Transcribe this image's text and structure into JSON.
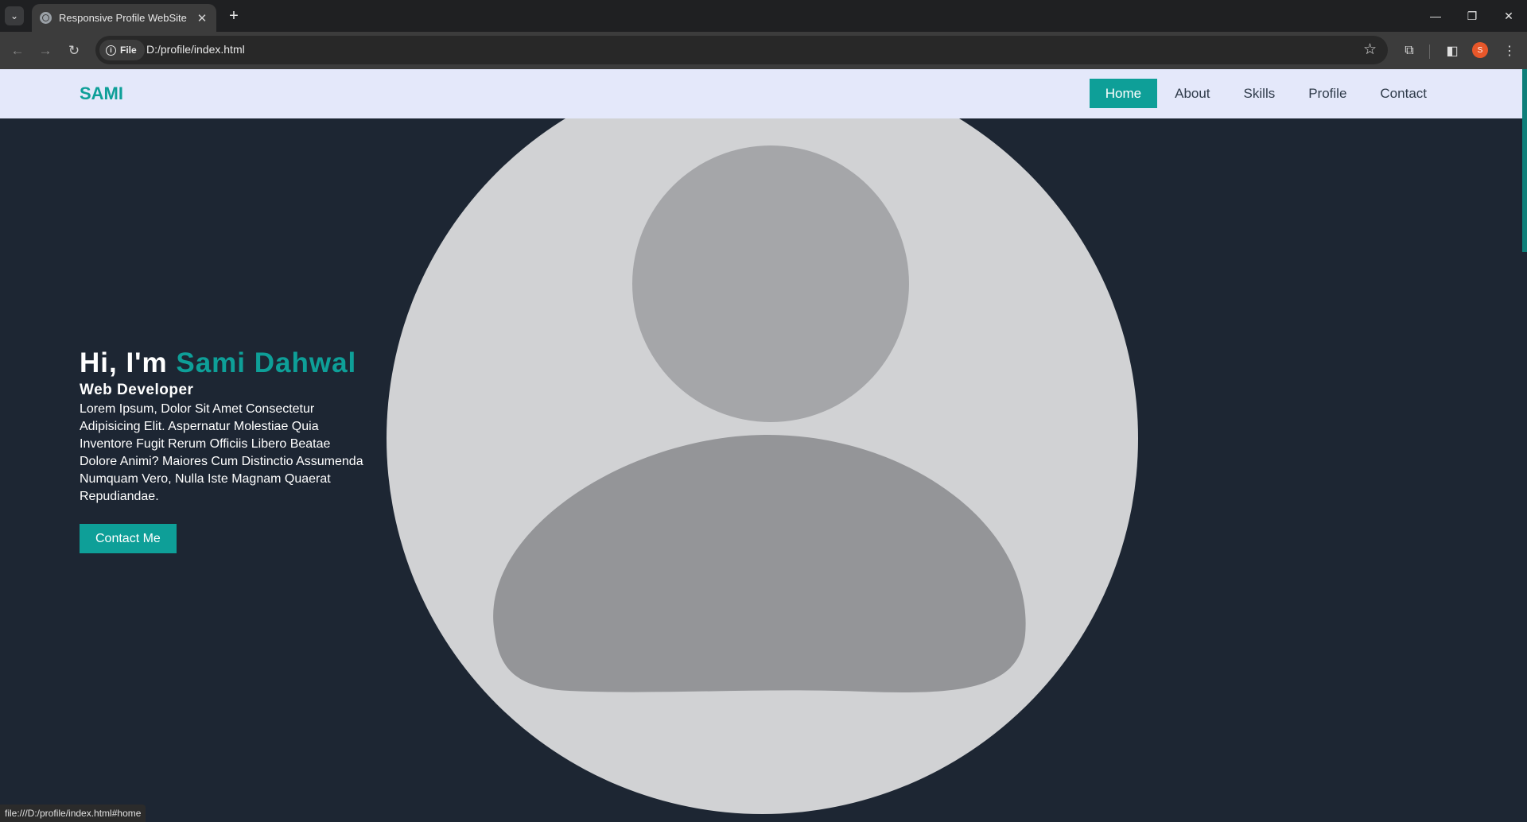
{
  "browser": {
    "tab_title": "Responsive Profile WebSite",
    "tab_close": "✕",
    "new_tab": "+",
    "security_chip": "File",
    "url": "D:/profile/index.html",
    "status_url": "file:///D:/profile/index.html#home",
    "profile_initial": "S",
    "icons": [
      "tab-search-icon",
      "globe-icon",
      "close-icon",
      "plus-icon",
      "back-icon",
      "forward-icon",
      "reload-icon",
      "info-icon",
      "star-icon",
      "extensions-icon",
      "side-panel-icon",
      "minimize-icon",
      "restore-icon",
      "window-close-icon"
    ]
  },
  "site": {
    "logo": "SAMI",
    "nav": [
      {
        "label": "Home",
        "active": true
      },
      {
        "label": "About",
        "active": false
      },
      {
        "label": "Skills",
        "active": false
      },
      {
        "label": "Profile",
        "active": false
      },
      {
        "label": "Contact",
        "active": false
      }
    ],
    "hero": {
      "greeting": "Hi, I'm",
      "name": "Sami Dahwal",
      "role": "Web Developer",
      "description": "Lorem Ipsum, Dolor Sit Amet Consectetur Adipisicing Elit. Aspernatur Molestiae Quia Inventore Fugit Rerum Officiis Libero Beatae Dolore Animi? Maiores Cum Distinctio Assumenda Numquam Vero, Nulla Iste Magnam Quaerat Repudiandae.",
      "cta": "Contact Me"
    }
  },
  "colors": {
    "accent": "#0e9f98",
    "page_background": "#1d2633",
    "header_background": "#e4e8fa",
    "avatar_circle": "#d1d2d4",
    "avatar_head": "#a5a6a9",
    "avatar_body": "#949598"
  }
}
